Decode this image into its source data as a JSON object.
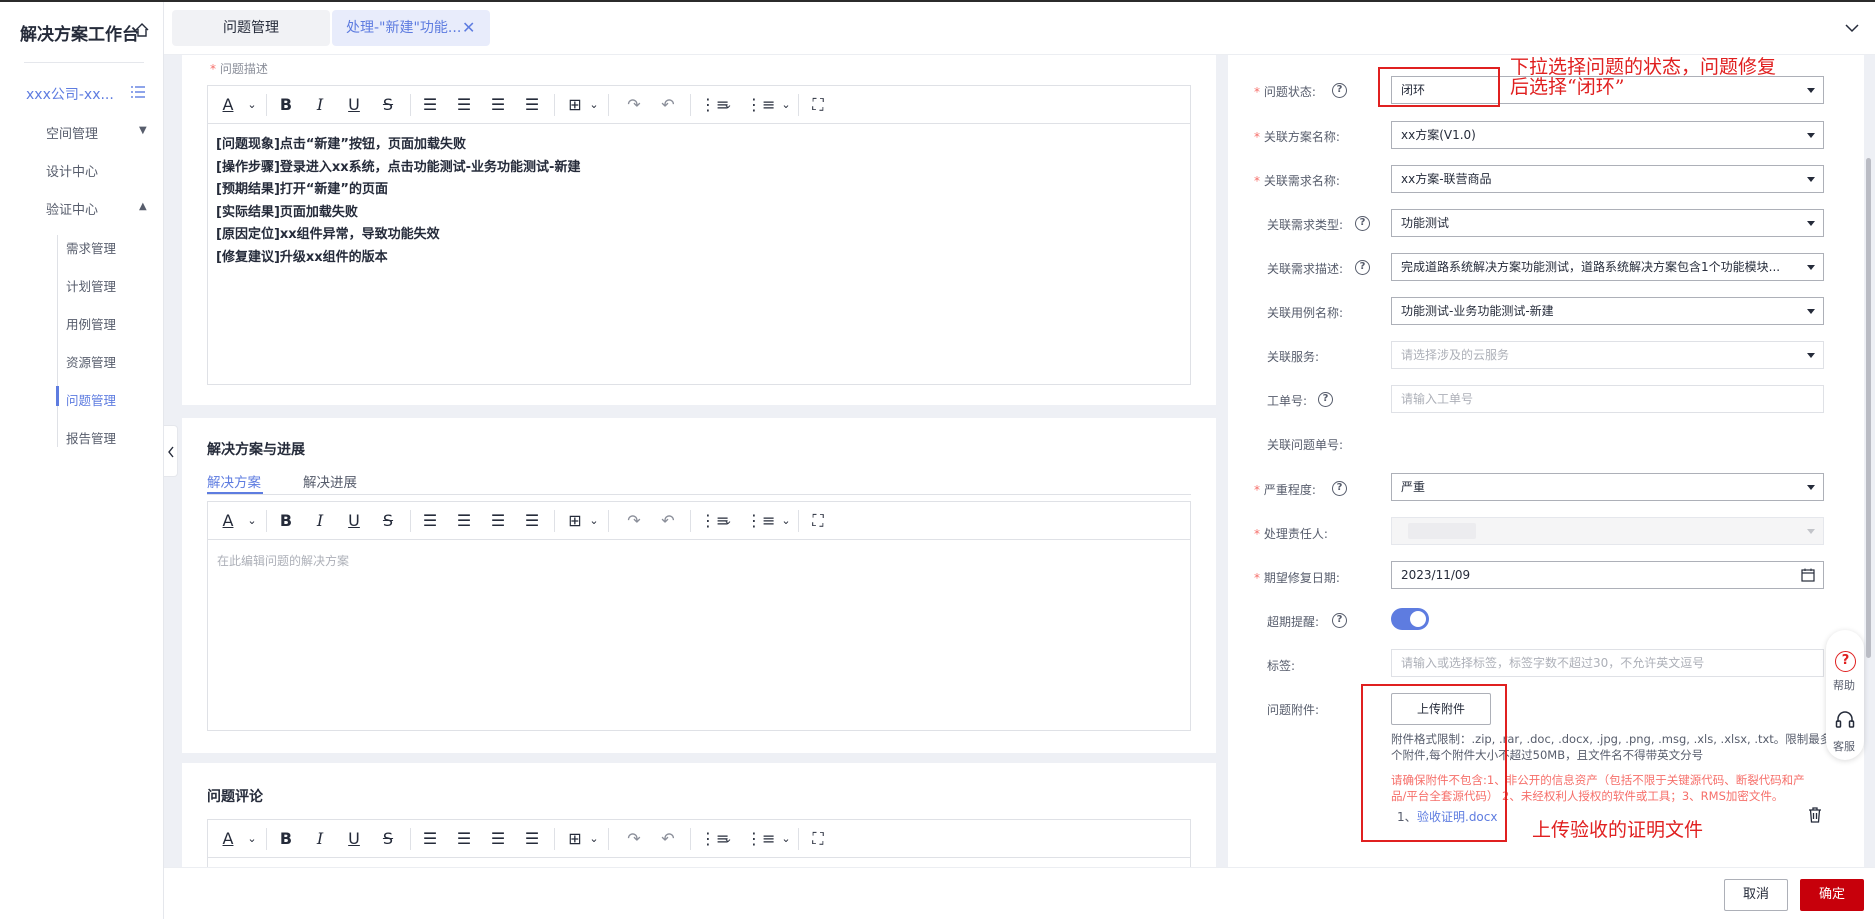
{
  "sidebar": {
    "title": "解决方案工作台",
    "project": "xxx公司-xx...",
    "items": [
      {
        "label": "空间管理"
      },
      {
        "label": "设计中心"
      },
      {
        "label": "验证中心"
      }
    ],
    "subitems": [
      {
        "label": "需求管理"
      },
      {
        "label": "计划管理"
      },
      {
        "label": "用例管理"
      },
      {
        "label": "资源管理"
      },
      {
        "label": "问题管理"
      },
      {
        "label": "报告管理"
      }
    ]
  },
  "tabs": [
    {
      "label": "问题管理"
    },
    {
      "label": "处理-\"新建\"功能..."
    }
  ],
  "description": {
    "label": "问题描述",
    "lines": [
      "[问题现象]点击“新建”按钮，页面加载失败",
      "[操作步骤]登录进入xx系统，点击功能测试-业务功能测试-新建",
      "[预期结果]打开“新建”的页面",
      "[实际结果]页面加载失败",
      "[原因定位]xx组件异常，导致功能失效",
      "[修复建议]升级xx组件的版本"
    ]
  },
  "solution": {
    "title": "解决方案与进展",
    "tab_active": "解决方案",
    "tab_other": "解决进展",
    "placeholder": "在此编辑问题的解决方案"
  },
  "comments": {
    "title": "问题评论"
  },
  "form": {
    "status": {
      "label": "问题状态:",
      "value": "闭环"
    },
    "solution_name": {
      "label": "关联方案名称:",
      "value": "xx方案(V1.0)"
    },
    "requirement_name": {
      "label": "关联需求名称:",
      "value": "xx方案-联营商品"
    },
    "requirement_type": {
      "label": "关联需求类型:",
      "value": "功能测试"
    },
    "requirement_desc": {
      "label": "关联需求描述:",
      "value": "完成道路系统解决方案功能测试，道路系统解决方案包含1个功能模块..."
    },
    "case_name": {
      "label": "关联用例名称:",
      "value": "功能测试-业务功能测试-新建"
    },
    "service": {
      "label": "关联服务:",
      "placeholder": "请选择涉及的云服务"
    },
    "ticket": {
      "label": "工单号:",
      "placeholder": "请输入工单号"
    },
    "issue_no": {
      "label": "关联问题单号:"
    },
    "severity": {
      "label": "严重程度:",
      "value": "严重"
    },
    "owner": {
      "label": "处理责任人:"
    },
    "due_date": {
      "label": "期望修复日期:",
      "value": "2023/11/09"
    },
    "overdue": {
      "label": "超期提醒:",
      "on": true
    },
    "tags": {
      "label": "标签:",
      "placeholder": "请输入或选择标签，标签字数不超过30，不允许英文逗号"
    },
    "attachment": {
      "label": "问题附件:",
      "upload_button": "上传附件",
      "hint_line1": "附件格式限制：.zip, .rar, .doc, .docx, .jpg, .png, .msg, .xls, .xlsx, .txt。限制最多5",
      "hint_line2": "个附件,每个附件大小不超过50MB，且文件名不得带英文分号",
      "warn_line1": "请确保附件不包含:1、非公开的信息资产（包括不限于关键源代码、断裂代码和产",
      "warn_line2": "品/平台全套源代码）  2、未经权利人授权的软件或工具；3、RMS加密文件。",
      "file_index": "1、",
      "file_name": "验收证明.docx"
    }
  },
  "annotations": {
    "status_note_line1": "下拉选择问题的状态，问题修复",
    "status_note_line2": "后选择“闭环”",
    "upload_note": "上传验收的证明文件"
  },
  "float": {
    "help": "帮助",
    "service": "客服"
  },
  "footer": {
    "cancel": "取消",
    "confirm": "确定"
  },
  "colors": {
    "primary": "#5e7ce0",
    "danger": "#c7000b",
    "annotation": "#e02020"
  }
}
